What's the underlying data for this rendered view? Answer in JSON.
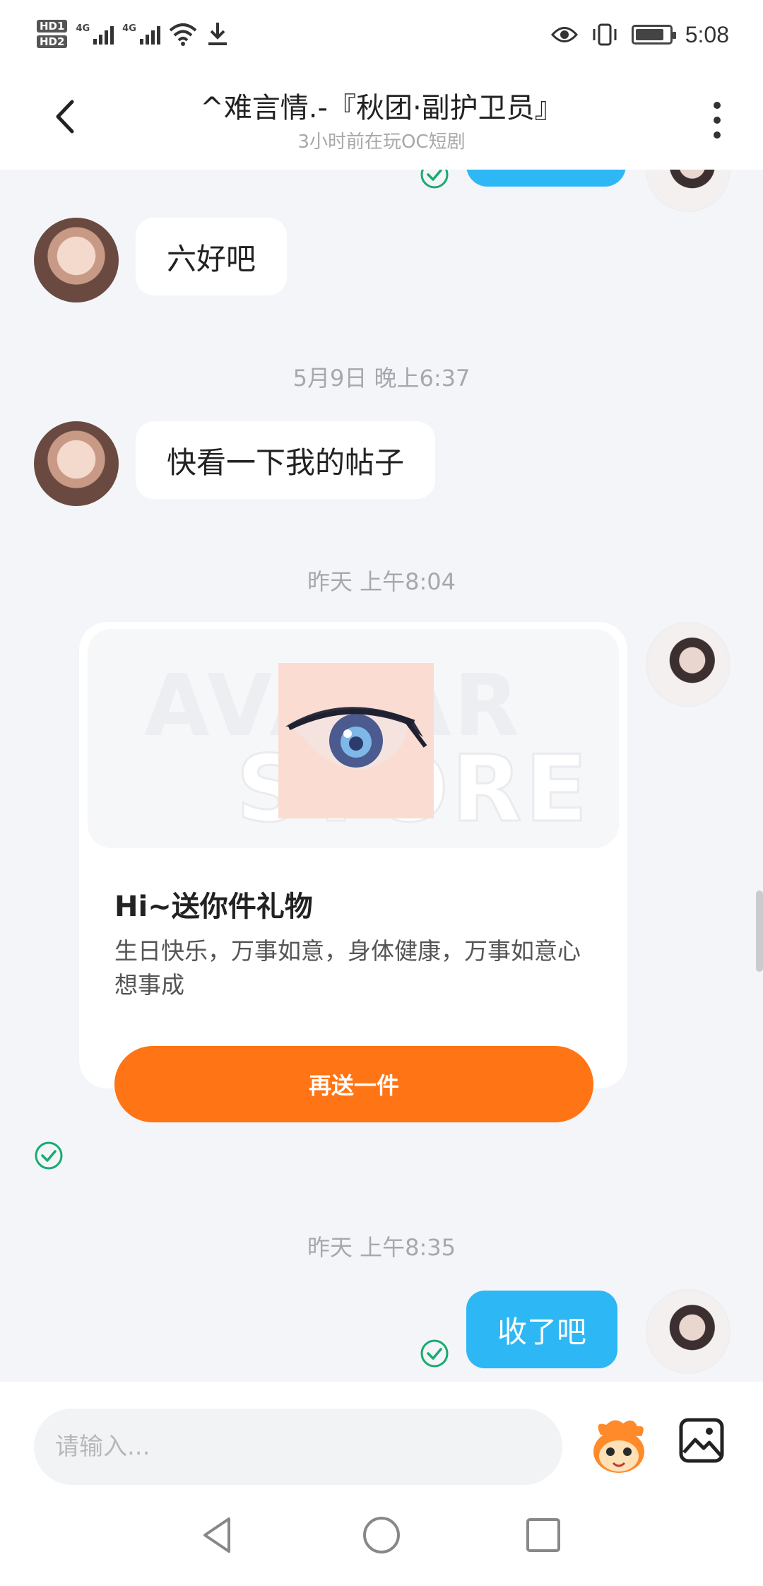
{
  "status_bar": {
    "time": "5:08",
    "hd_badges": [
      "HD1",
      "HD2"
    ],
    "signal_labels": [
      "4G",
      "4G"
    ],
    "battery_level": 0.85
  },
  "header": {
    "title": "^难言情.-『秋团·副护卫员』",
    "subtitle": "3小时前在玩OC短剧"
  },
  "messages": [
    {
      "type": "text",
      "direction": "in",
      "text": "六好吧"
    },
    {
      "type": "timestamp",
      "text": "5月9日 晚上6:37"
    },
    {
      "type": "text",
      "direction": "in",
      "text": "快看一下我的帖子"
    },
    {
      "type": "timestamp",
      "text": "昨天 上午8:04"
    },
    {
      "type": "gift",
      "direction": "out",
      "image_watermark": [
        "AVATAR",
        "STORE"
      ],
      "title": "Hi~送你件礼物",
      "description": "生日快乐，万事如意，身体健康，万事如意心想事成",
      "button_label": "再送一件"
    },
    {
      "type": "timestamp",
      "text": "昨天 上午8:35"
    },
    {
      "type": "text",
      "direction": "out",
      "text": "收了吧"
    }
  ],
  "input": {
    "placeholder": "请输入..."
  },
  "colors": {
    "outgoing_bubble": "#2db7f5",
    "gift_button": "#ff7414",
    "read_check": "#1aaa6e",
    "background": "#f3f5f9"
  },
  "icons": {
    "back": "chevron-left-icon",
    "more": "more-vertical-icon",
    "emoji": "mascot-emoji-icon",
    "image": "image-icon",
    "nav": [
      "back-triangle-icon",
      "home-circle-icon",
      "recents-square-icon"
    ]
  }
}
